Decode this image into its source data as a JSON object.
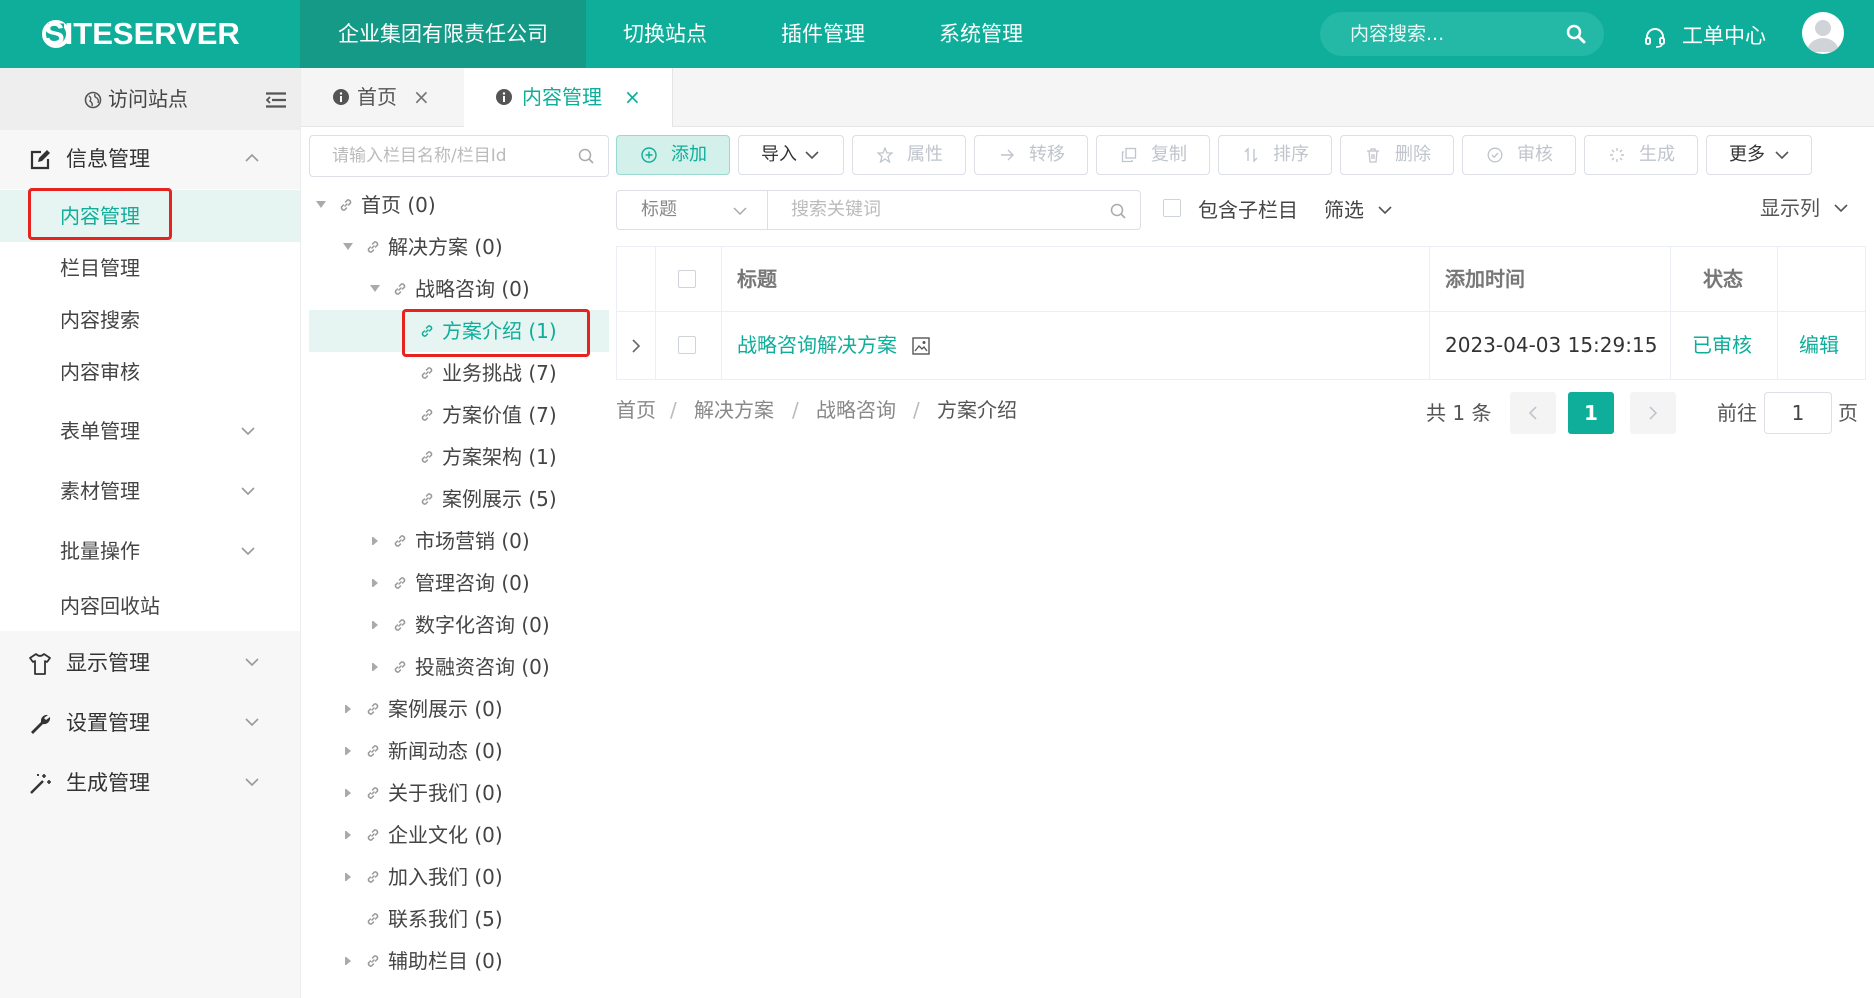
{
  "header": {
    "logo_text": "SITESERVER",
    "nav": [
      "企业集团有限责任公司",
      "切换站点",
      "插件管理",
      "系统管理"
    ],
    "search_placeholder": "内容搜索...",
    "ticket_label": "工单中心",
    "colors": {
      "brand": "#0fae9a",
      "nav_active": "#169a88",
      "highlight": "#e6231f"
    }
  },
  "sidebar": {
    "visit_label": "访问站点",
    "groups": [
      {
        "label": "信息管理",
        "icon": "edit-icon",
        "expanded": true
      },
      {
        "label": "显示管理",
        "icon": "shirt-icon"
      },
      {
        "label": "设置管理",
        "icon": "wrench-icon"
      },
      {
        "label": "生成管理",
        "icon": "magic-wand-icon"
      }
    ],
    "sub_items": [
      {
        "label": "内容管理",
        "active": true
      },
      {
        "label": "栏目管理"
      },
      {
        "label": "内容搜索"
      },
      {
        "label": "内容审核"
      },
      {
        "label": "表单管理",
        "has_children": true
      },
      {
        "label": "素材管理",
        "has_children": true
      },
      {
        "label": "批量操作",
        "has_children": true
      },
      {
        "label": "内容回收站"
      }
    ]
  },
  "tabs": [
    {
      "label": "首页",
      "close": "×"
    },
    {
      "label": "内容管理",
      "close": "×",
      "active": true
    }
  ],
  "tree": {
    "search_placeholder": "请输入栏目名称/栏目Id",
    "nodes": [
      {
        "label": "首页 (0)",
        "level": 0,
        "state": "open"
      },
      {
        "label": "解决方案 (0)",
        "level": 1,
        "state": "open"
      },
      {
        "label": "战略咨询 (0)",
        "level": 2,
        "state": "open"
      },
      {
        "label": "方案介绍 (1)",
        "level": 3,
        "state": "leaf",
        "selected": true
      },
      {
        "label": "业务挑战 (7)",
        "level": 3,
        "state": "leaf"
      },
      {
        "label": "方案价值 (7)",
        "level": 3,
        "state": "leaf"
      },
      {
        "label": "方案架构 (1)",
        "level": 3,
        "state": "leaf"
      },
      {
        "label": "案例展示 (5)",
        "level": 3,
        "state": "leaf"
      },
      {
        "label": "市场营销 (0)",
        "level": 2,
        "state": "closed"
      },
      {
        "label": "管理咨询 (0)",
        "level": 2,
        "state": "closed"
      },
      {
        "label": "数字化咨询 (0)",
        "level": 2,
        "state": "closed"
      },
      {
        "label": "投融资咨询 (0)",
        "level": 2,
        "state": "closed"
      },
      {
        "label": "案例展示 (0)",
        "level": 1,
        "state": "closed"
      },
      {
        "label": "新闻动态 (0)",
        "level": 1,
        "state": "closed"
      },
      {
        "label": "关于我们 (0)",
        "level": 1,
        "state": "closed"
      },
      {
        "label": "企业文化 (0)",
        "level": 1,
        "state": "closed"
      },
      {
        "label": "加入我们 (0)",
        "level": 1,
        "state": "closed"
      },
      {
        "label": "联系我们 (5)",
        "level": 1,
        "state": "leaf"
      },
      {
        "label": "辅助栏目 (0)",
        "level": 1,
        "state": "closed"
      }
    ]
  },
  "toolbar": {
    "add": "添加",
    "import": "导入",
    "attributes": "属性",
    "transfer": "转移",
    "copy": "复制",
    "sort": "排序",
    "delete": "删除",
    "audit": "审核",
    "generate": "生成",
    "more": "更多"
  },
  "filter": {
    "field_value": "标题",
    "keyword_placeholder": "搜索关键词",
    "include_children": "包含子栏目",
    "filter_label": "筛选",
    "display_columns": "显示列"
  },
  "table": {
    "columns": [
      "标题",
      "添加时间",
      "状态"
    ],
    "rows": [
      {
        "title": "战略咨询解决方案",
        "added": "2023-04-03 15:29:15",
        "status": "已审核",
        "action": "编辑"
      }
    ]
  },
  "breadcrumb": [
    "首页",
    "解决方案",
    "战略咨询",
    "方案介绍"
  ],
  "breadcrumb_sep": "/",
  "pagination": {
    "total": "共 1 条",
    "current": "1",
    "goto_label": "前往",
    "goto_value": "1",
    "page_suffix": "页"
  }
}
